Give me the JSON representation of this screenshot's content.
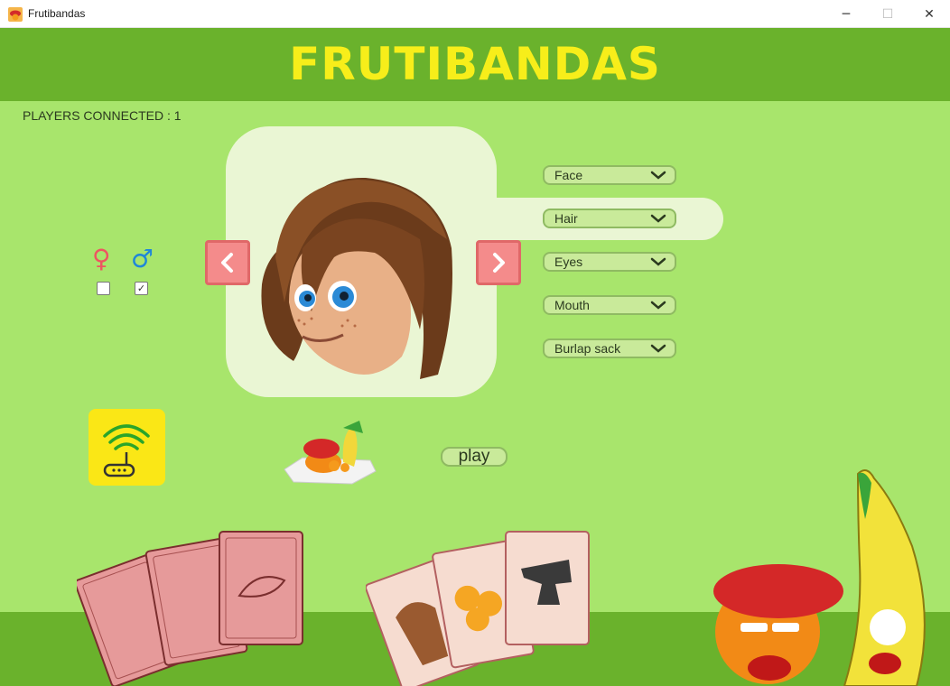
{
  "window": {
    "title": "Frutibandas",
    "app_icon": "beret-icon",
    "controls": {
      "minimize": "─",
      "maximize": "☐",
      "close": "✕"
    }
  },
  "header": {
    "game_title": "FRUTIBANDAS"
  },
  "status": {
    "players_connected": "PLAYERS CONNECTED : 1"
  },
  "gender": {
    "female_symbol": "♀",
    "male_symbol": "♂",
    "female_checked": false,
    "male_checked": true,
    "check_mark": "✓"
  },
  "customization": {
    "selects": [
      {
        "value": "Face"
      },
      {
        "value": "Hair"
      },
      {
        "value": "Eyes"
      },
      {
        "value": "Mouth"
      },
      {
        "value": "Burlap sack"
      }
    ],
    "highlighted_index": 1
  },
  "actions": {
    "play_label": "play"
  },
  "colors": {
    "background": "#a8e56c",
    "band": "#6ab22c",
    "title": "#f7ee1a",
    "panel": "#eaf6d4",
    "arrow_button": "#f48b8b",
    "connect_button": "#fae716"
  }
}
